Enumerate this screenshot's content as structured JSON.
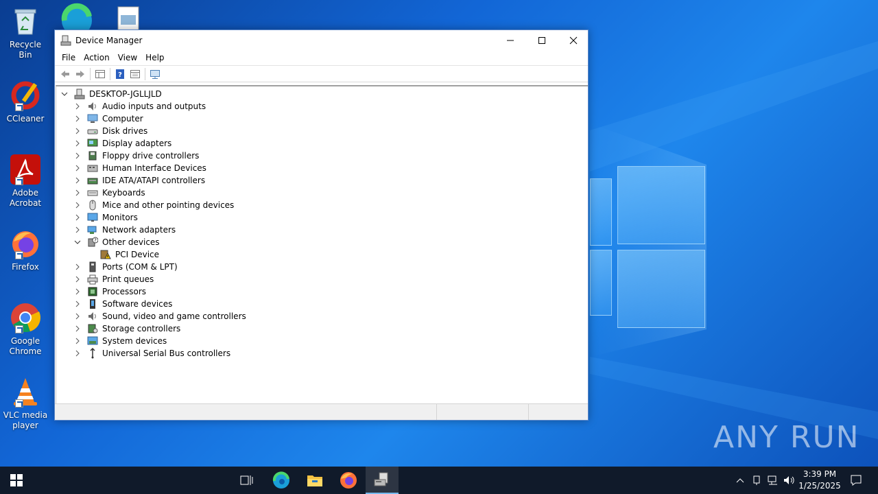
{
  "desktop": {
    "icons": [
      {
        "label": "Recycle Bin"
      },
      {
        "label": "CCleaner"
      },
      {
        "label": "Adobe Acrobat"
      },
      {
        "label": "Firefox"
      },
      {
        "label": "Google Chrome"
      },
      {
        "label": "VLC media player"
      }
    ],
    "watermark": "ANY RUN"
  },
  "window": {
    "title": "Device Manager",
    "menu": [
      "File",
      "Action",
      "View",
      "Help"
    ],
    "root": "DESKTOP-JGLLJLD",
    "categories": [
      {
        "label": "Audio inputs and outputs",
        "icon": "speaker-icon",
        "expanded": false
      },
      {
        "label": "Computer",
        "icon": "computer-icon",
        "expanded": false
      },
      {
        "label": "Disk drives",
        "icon": "disk-drive-icon",
        "expanded": false
      },
      {
        "label": "Display adapters",
        "icon": "display-adapter-icon",
        "expanded": false
      },
      {
        "label": "Floppy drive controllers",
        "icon": "floppy-controller-icon",
        "expanded": false
      },
      {
        "label": "Human Interface Devices",
        "icon": "hid-icon",
        "expanded": false
      },
      {
        "label": "IDE ATA/ATAPI controllers",
        "icon": "ide-controller-icon",
        "expanded": false
      },
      {
        "label": "Keyboards",
        "icon": "keyboard-icon",
        "expanded": false
      },
      {
        "label": "Mice and other pointing devices",
        "icon": "mouse-icon",
        "expanded": false
      },
      {
        "label": "Monitors",
        "icon": "monitor-icon",
        "expanded": false
      },
      {
        "label": "Network adapters",
        "icon": "network-adapter-icon",
        "expanded": false
      },
      {
        "label": "Other devices",
        "icon": "unknown-device-icon",
        "expanded": true
      },
      {
        "label": "PCI Device",
        "icon": "warning-device-icon",
        "child": true
      },
      {
        "label": "Ports (COM & LPT)",
        "icon": "port-icon",
        "expanded": false
      },
      {
        "label": "Print queues",
        "icon": "printer-icon",
        "expanded": false
      },
      {
        "label": "Processors",
        "icon": "processor-icon",
        "expanded": false
      },
      {
        "label": "Software devices",
        "icon": "software-device-icon",
        "expanded": false
      },
      {
        "label": "Sound, video and game controllers",
        "icon": "sound-icon",
        "expanded": false
      },
      {
        "label": "Storage controllers",
        "icon": "storage-controller-icon",
        "expanded": false
      },
      {
        "label": "System devices",
        "icon": "system-device-icon",
        "expanded": false
      },
      {
        "label": "Universal Serial Bus controllers",
        "icon": "usb-icon",
        "expanded": false
      }
    ]
  },
  "taskbar": {
    "time": "3:39 PM",
    "date": "1/25/2025"
  }
}
